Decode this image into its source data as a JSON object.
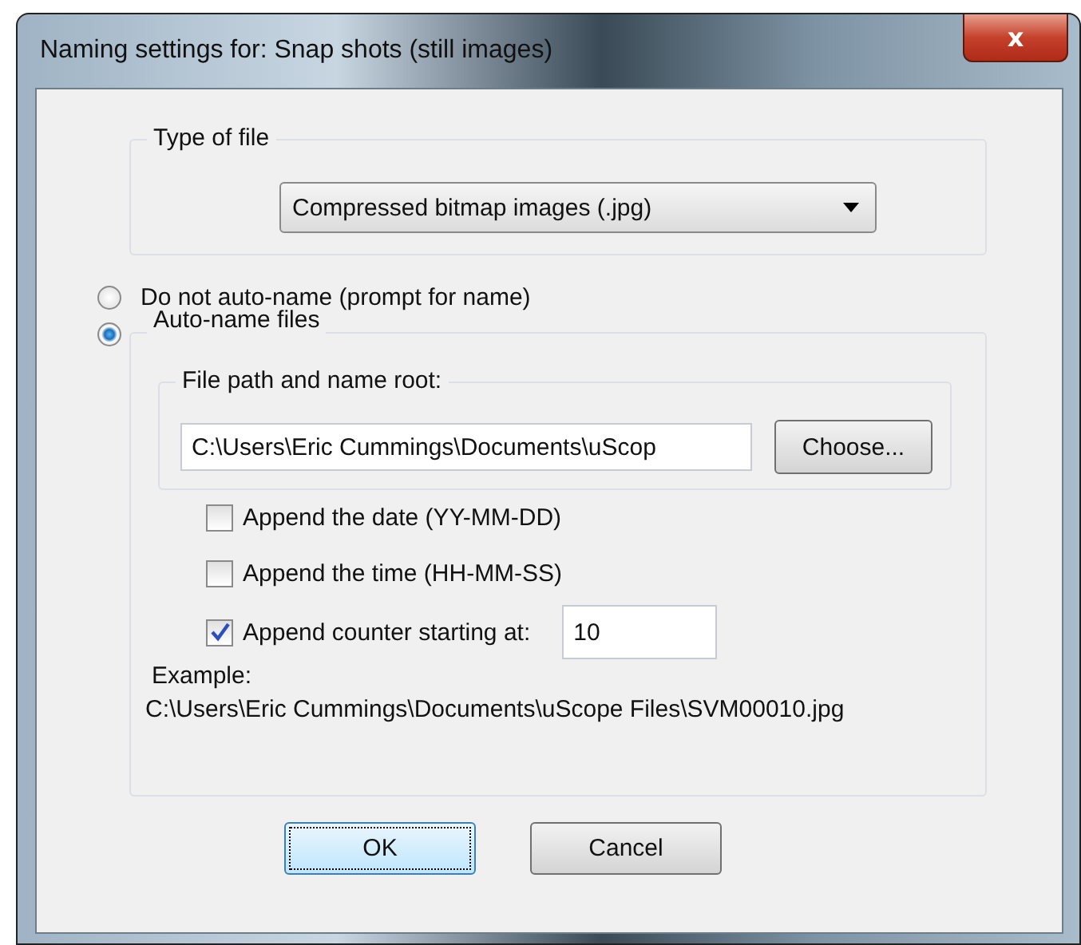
{
  "window": {
    "title": "Naming settings for: Snap shots (still images)",
    "close": "x"
  },
  "file_type": {
    "legend": "Type of file",
    "value": "Compressed bitmap images (.jpg)"
  },
  "naming_options": [
    {
      "label": "Do not auto-name (prompt for name)",
      "selected": false
    },
    {
      "label": "Auto-name files",
      "selected": true
    }
  ],
  "path": {
    "legend": "File path and name root:",
    "value": "C:\\Users\\Eric Cummings\\Documents\\uScop",
    "button": "Choose..."
  },
  "appends": [
    {
      "label": "Append the date (YY-MM-DD)",
      "checked": false
    },
    {
      "label": "Append the time (HH-MM-SS)",
      "checked": false
    },
    {
      "label": "Append counter starting at:",
      "checked": true,
      "value": "10"
    }
  ],
  "example": {
    "label": "Example:",
    "value": "C:\\Users\\Eric Cummings\\Documents\\uScope Files\\SVM00010.jpg"
  },
  "buttons": [
    {
      "label": "OK",
      "default": true
    },
    {
      "label": "Cancel",
      "default": false
    }
  ]
}
